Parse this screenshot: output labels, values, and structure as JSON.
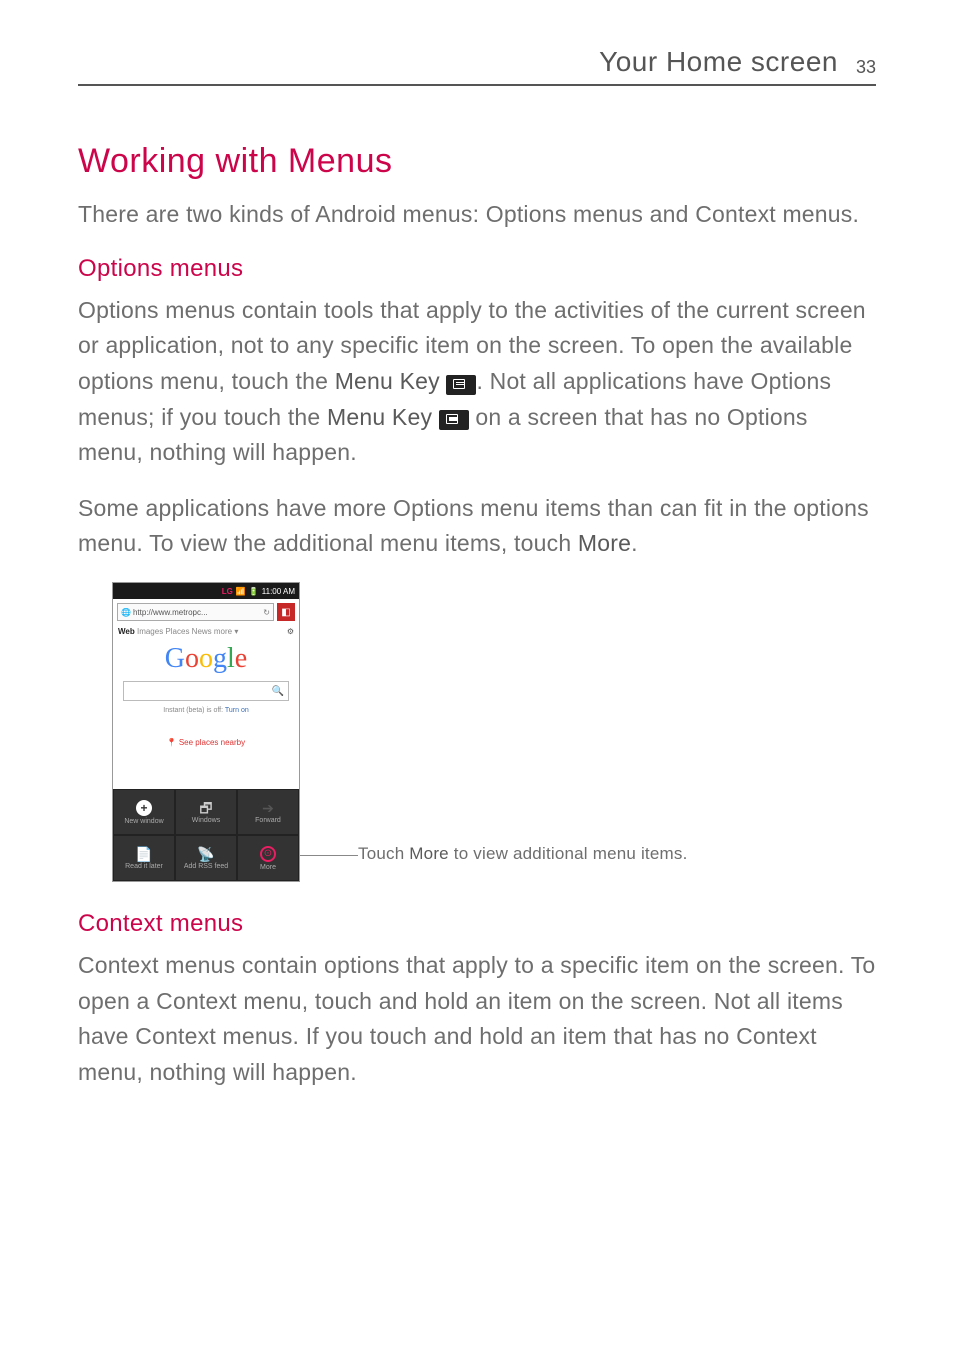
{
  "header": {
    "section": "Your Home screen",
    "page": "33"
  },
  "h1": "Working with Menus",
  "intro": "There are two kinds of Android menus: Options menus and Context menus.",
  "options": {
    "heading": "Options menus",
    "p1a": "Options menus contain tools that apply to the activities of the current screen or application, not to any specific item on the screen. To open the available options menu, touch the ",
    "p1b": "Menu Key",
    "p1c": " ",
    "p1d": ". Not all applications have Options menus; if you touch the ",
    "p1e": "Menu Key",
    "p1f": " ",
    "p1g": " on a screen that has no Options menu, nothing will happen.",
    "p2a": "Some applications have more Options menu items than can fit in the options menu. To view the additional menu items, touch ",
    "p2b": "More",
    "p2c": "."
  },
  "screenshot": {
    "status_lg": "LG",
    "status_time": "11:00 AM",
    "url": "http://www.metropc...",
    "refresh": "↻",
    "bookmark": "◧",
    "nav_web": "Web",
    "nav_rest": "  Images  Places  News  more ▾",
    "gear": "⚙",
    "search_icon": "🔍",
    "instant_a": "Instant (beta) is off: ",
    "instant_b": "Turn on",
    "places": "See places nearby",
    "menu": {
      "new_window": "New window",
      "windows": "Windows",
      "forward": "Forward",
      "read_later": "Read it later",
      "add_rss": "Add RSS feed",
      "more": "More"
    }
  },
  "callout": {
    "a": "Touch ",
    "b": "More",
    "c": " to view additional menu items."
  },
  "context": {
    "heading": "Context menus",
    "p": "Context menus contain options that apply to a specific item on the screen. To open a Context menu, touch and hold an item on the screen. Not all items have Context menus. If you touch and hold an item that has no Context menu, nothing will happen."
  }
}
